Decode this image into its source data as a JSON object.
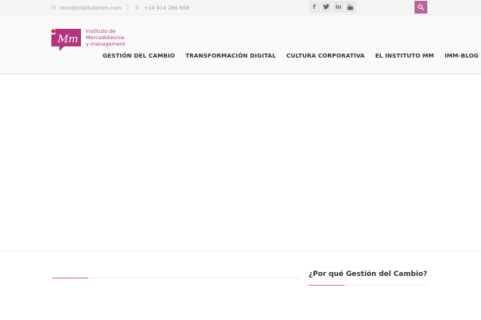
{
  "topbar": {
    "email": "imm@institutomm.com",
    "phone": "+34 914 266 669",
    "social": [
      "facebook-icon",
      "twitter-icon",
      "linkedin-icon",
      "youtube-icon"
    ]
  },
  "logo": {
    "line1": "Instituto de",
    "line2": "Mercadotecnia",
    "line3": "y management"
  },
  "nav": {
    "items": [
      "GESTIÓN DEL CAMBIO",
      "TRANSFORMACIÓN DIGITAL",
      "CULTURA CORPORATIVA",
      "EL INSTITUTO MM",
      "IMM-BLOG"
    ]
  },
  "sidebar": {
    "title": "¿Por qué Gestión del Cambio?"
  },
  "colors": {
    "accent": "#b9659b",
    "brand": "#b3357f",
    "underline": "#d86a9d"
  }
}
